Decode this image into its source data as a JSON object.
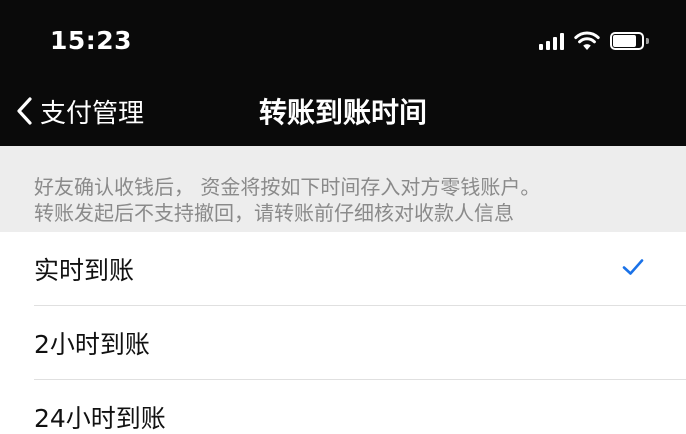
{
  "status_bar": {
    "time": "15:23",
    "icons": [
      "signal-icon",
      "wifi-icon",
      "battery-icon"
    ]
  },
  "nav": {
    "back_label": "支付管理",
    "back_icon": "chevron-left-icon",
    "title": "转账到账时间"
  },
  "notice": {
    "lines": [
      "好友确认收钱后， 资金将按如下时间存入对方零钱账户。",
      "转账发起后不支持撤回，请转账前仔细核对收款人信息"
    ]
  },
  "options": [
    {
      "label": "实时到账",
      "selected": true
    },
    {
      "label": "2小时到账",
      "selected": false
    },
    {
      "label": "24小时到账",
      "selected": false
    }
  ],
  "colors": {
    "bar_background": "#0a0a0a",
    "notice_background": "#ededed",
    "notice_text": "#8a8a8a",
    "accent_check": "#1a72e8"
  }
}
